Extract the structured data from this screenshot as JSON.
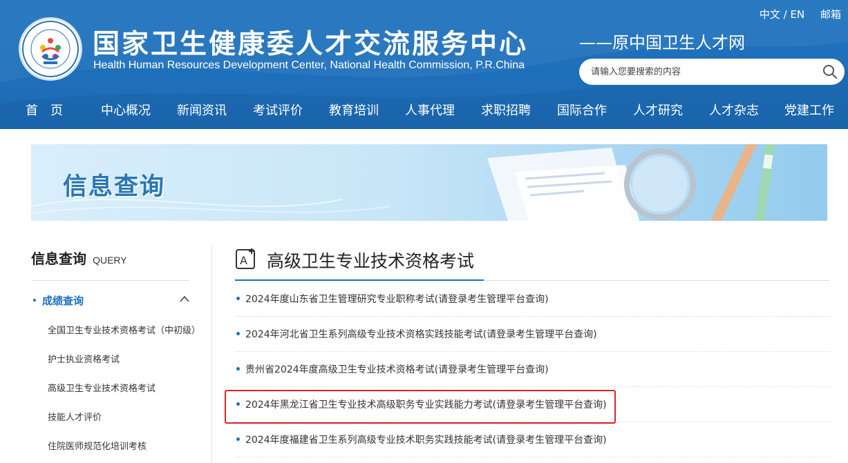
{
  "header": {
    "title": "国家卫生健康委人才交流服务中心",
    "subtitle_en": "Health Human Resources Development Center, National Health Commission, P.R.China",
    "slogan": "——原中国卫生人才网",
    "top_links": {
      "language": "中文 / EN",
      "mail": "邮箱"
    },
    "search": {
      "placeholder": "请输入您要搜索的内容"
    },
    "logo_icon": "center-emblem-logo"
  },
  "nav": [
    {
      "label": "首　页"
    },
    {
      "label": "中心概况"
    },
    {
      "label": "新闻资讯"
    },
    {
      "label": "考试评价"
    },
    {
      "label": "教育培训"
    },
    {
      "label": "人事代理"
    },
    {
      "label": "求职招聘"
    },
    {
      "label": "国际合作"
    },
    {
      "label": "人才研究"
    },
    {
      "label": "人才杂志"
    },
    {
      "label": "党建工作"
    }
  ],
  "banner": {
    "title": "信息查询"
  },
  "sidebar": {
    "title_cn": "信息查询",
    "title_en": "QUERY",
    "active": {
      "label": "成绩查询",
      "icon": "chevron-up-icon"
    },
    "items": [
      {
        "label": "全国卫生专业技术资格考试（中初级）"
      },
      {
        "label": "护士执业资格考试"
      },
      {
        "label": "高级卫生专业技术资格考试"
      },
      {
        "label": "技能人才评价"
      },
      {
        "label": "住院医师规范化培训考核"
      }
    ]
  },
  "main": {
    "title": "高级卫生专业技术资格考试",
    "title_icon": "edit-text-icon",
    "items": [
      {
        "text": "2024年度山东省卫生管理研究专业职称考试(请登录考生管理平台查询)"
      },
      {
        "text": "2024年河北省卫生系列高级专业技术资格实践技能考试(请登录考生管理平台查询)"
      },
      {
        "text": "贵州省2024年度高级卫生专业技术资格考试(请登录考生管理平台查询)"
      },
      {
        "text": "2024年黑龙江省卫生专业技术高级职务专业实践能力考试(请登录考生管理平台查询)"
      },
      {
        "text": "2024年度福建省卫生系列高级专业技术职务实践技能考试(请登录考生管理平台查询)"
      }
    ]
  },
  "colors": {
    "header_blue": "#1f73bf",
    "accent_blue": "#1d6fbe",
    "highlight_red": "#e02020"
  }
}
